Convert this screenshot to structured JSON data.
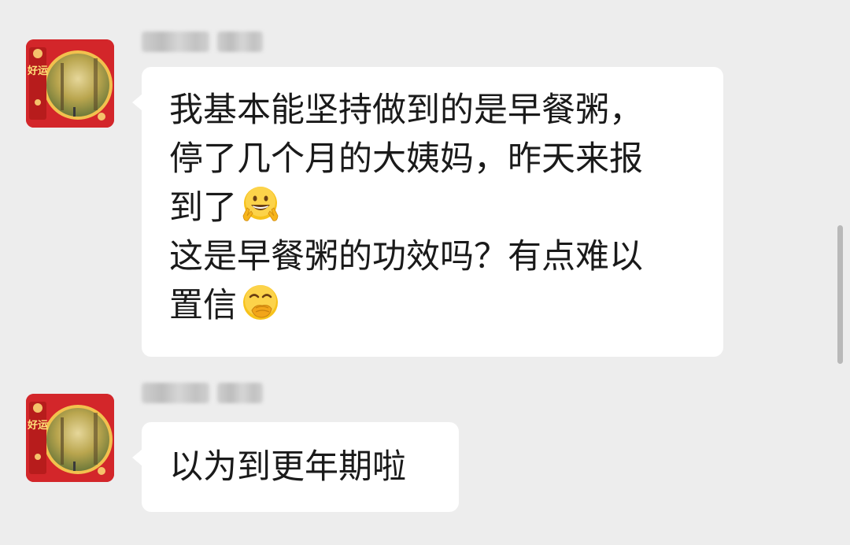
{
  "messages": [
    {
      "sender_blurred": true,
      "avatar": {
        "badge_text": "好运"
      },
      "lines": [
        {
          "text": "我基本能坚持做到的是早餐粥，"
        },
        {
          "text": "停了几个月的大姨妈，昨天来报"
        },
        {
          "text": "到了",
          "emoji": "grinning-peace-emoji"
        },
        {
          "text": "这是早餐粥的功效吗？有点难以"
        },
        {
          "text": "置信",
          "emoji": "hand-over-mouth-emoji"
        }
      ]
    },
    {
      "sender_blurred": true,
      "avatar": {
        "badge_text": "好运"
      },
      "lines": [
        {
          "text": "以为到更年期啦"
        }
      ]
    }
  ],
  "colors": {
    "background": "#ededed",
    "bubble": "#ffffff",
    "avatar_red": "#d3262a",
    "scrollbar": "#b9b9b9"
  }
}
